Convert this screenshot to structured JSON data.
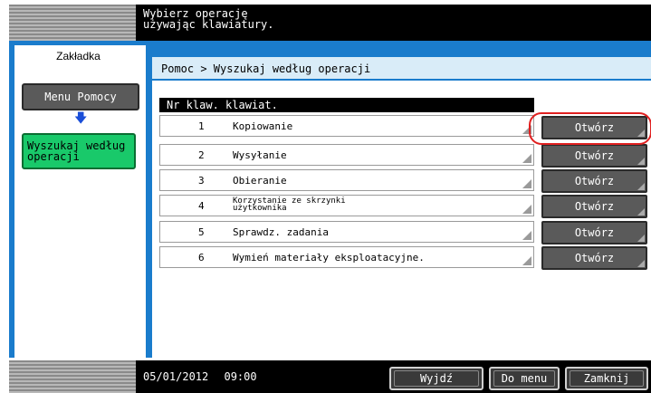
{
  "header": {
    "message": "Wybierz operację\nużywając klawiatury."
  },
  "sidebar": {
    "title": "Zakładka",
    "menu_button": "Menu Pomocy",
    "search_button": "Wyszukaj według\noperacji"
  },
  "breadcrumb": "Pomoc > Wyszukaj według operacji",
  "list": {
    "header": "Nr klaw. klawiat.",
    "rows": [
      {
        "num": "1",
        "label": "Kopiowanie",
        "open": "Otwórz"
      },
      {
        "num": "2",
        "label": "Wysyłanie",
        "open": "Otwórz"
      },
      {
        "num": "3",
        "label": "Obieranie",
        "open": "Otwórz"
      },
      {
        "num": "4",
        "label": "Korzystanie ze skrzynki\nużytkownika",
        "open": "Otwórz"
      },
      {
        "num": "5",
        "label": "Sprawdz. zadania",
        "open": "Otwórz"
      },
      {
        "num": "6",
        "label": "Wymień materiały eksploatacyjne.",
        "open": "Otwórz"
      }
    ]
  },
  "footer": {
    "date": "05/01/2012",
    "time": "09:00",
    "exit_button": "Wyjdź",
    "to_menu_button": "Do menu",
    "close_button": "Zamknij"
  },
  "colors": {
    "accent": "#1a7ccc",
    "active": "#19c96a",
    "highlight": "#e02020"
  }
}
